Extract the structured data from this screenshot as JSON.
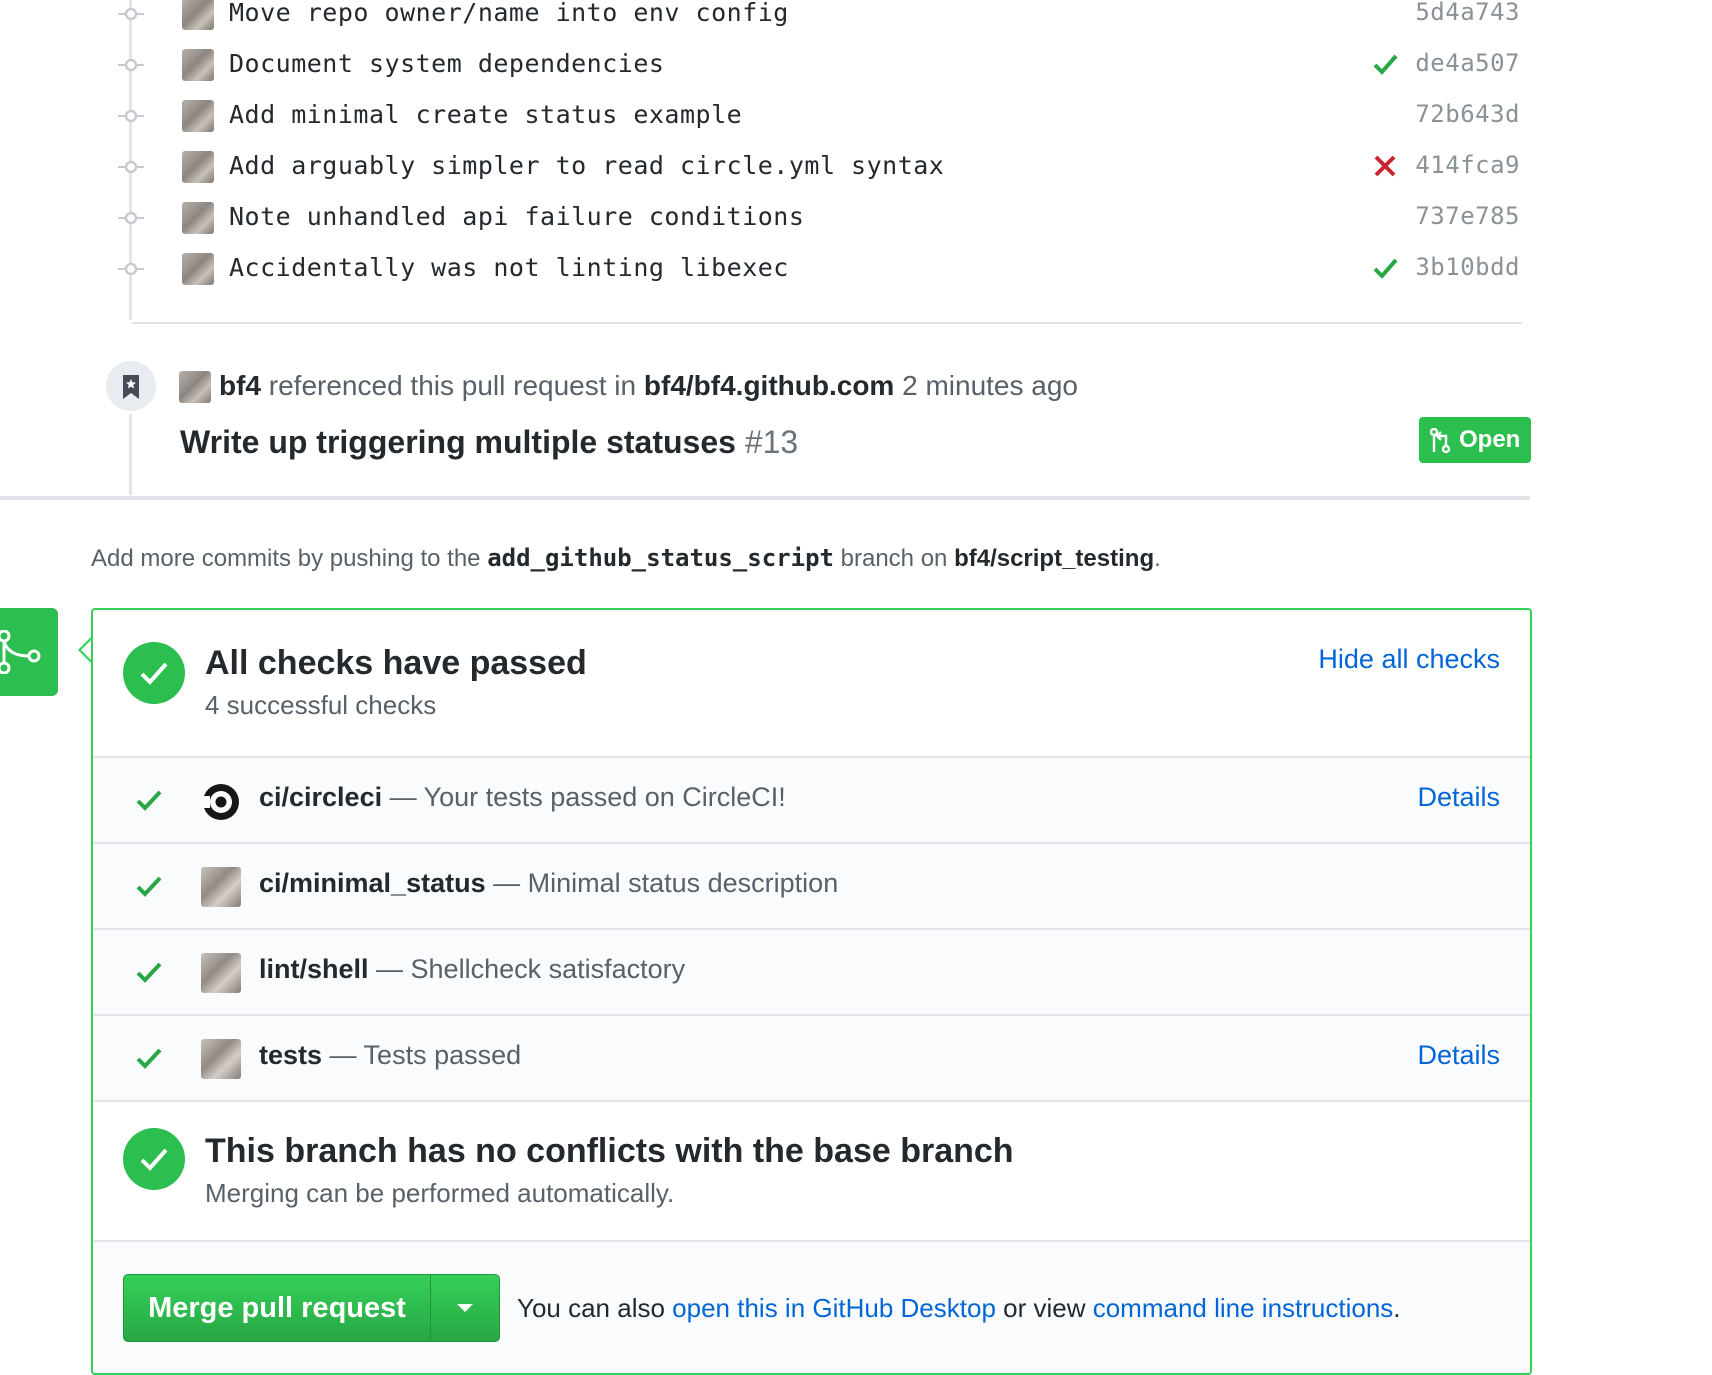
{
  "commits": [
    {
      "message": "Move repo owner/name into env config",
      "sha": "5d4a743",
      "status": "none"
    },
    {
      "message": "Document system dependencies",
      "sha": "de4a507",
      "status": "success"
    },
    {
      "message": "Add minimal create status example",
      "sha": "72b643d",
      "status": "none"
    },
    {
      "message": "Add arguably simpler to read circle.yml syntax",
      "sha": "414fca9",
      "status": "failure"
    },
    {
      "message": "Note unhandled api failure conditions",
      "sha": "737e785",
      "status": "none"
    },
    {
      "message": "Accidentally was not linting libexec",
      "sha": "3b10bdd",
      "status": "success"
    }
  ],
  "reference": {
    "user": "bf4",
    "text_mid": " referenced this pull request in ",
    "repo": "bf4/bf4.github.com",
    "time": " 2 minutes ago",
    "title": "Write up triggering multiple statuses",
    "number": " #13",
    "state": "Open"
  },
  "push_note": {
    "prefix": "Add more commits by pushing to the ",
    "branch": "add_github_status_script",
    "middle": " branch on ",
    "repo": "bf4/script_testing",
    "suffix": "."
  },
  "checks": {
    "title": "All checks have passed",
    "subtitle": "4 successful checks",
    "hide_link": "Hide all checks",
    "items": [
      {
        "name": "ci/circleci",
        "desc": " — Your tests passed on CircleCI!",
        "details": "Details",
        "icon": "circleci-logo-icon"
      },
      {
        "name": "ci/minimal_status",
        "desc": " — Minimal status description",
        "details": "",
        "icon": "avatar"
      },
      {
        "name": "lint/shell",
        "desc": " — Shellcheck satisfactory",
        "details": "",
        "icon": "avatar"
      },
      {
        "name": "tests",
        "desc": " — Tests passed",
        "details": "Details",
        "icon": "avatar"
      }
    ]
  },
  "conflicts": {
    "title": "This branch has no conflicts with the base branch",
    "subtitle": "Merging can be performed automatically."
  },
  "merge": {
    "button_label": "Merge pull request",
    "alt_prefix": "You can also ",
    "alt_link1": "open this in GitHub Desktop",
    "alt_middle": " or view ",
    "alt_link2": "command line instructions",
    "alt_suffix": "."
  },
  "colors": {
    "success": "#28a745",
    "failure": "#cb2431",
    "link": "#0366d6",
    "merge_green": "#2cbe4e"
  }
}
